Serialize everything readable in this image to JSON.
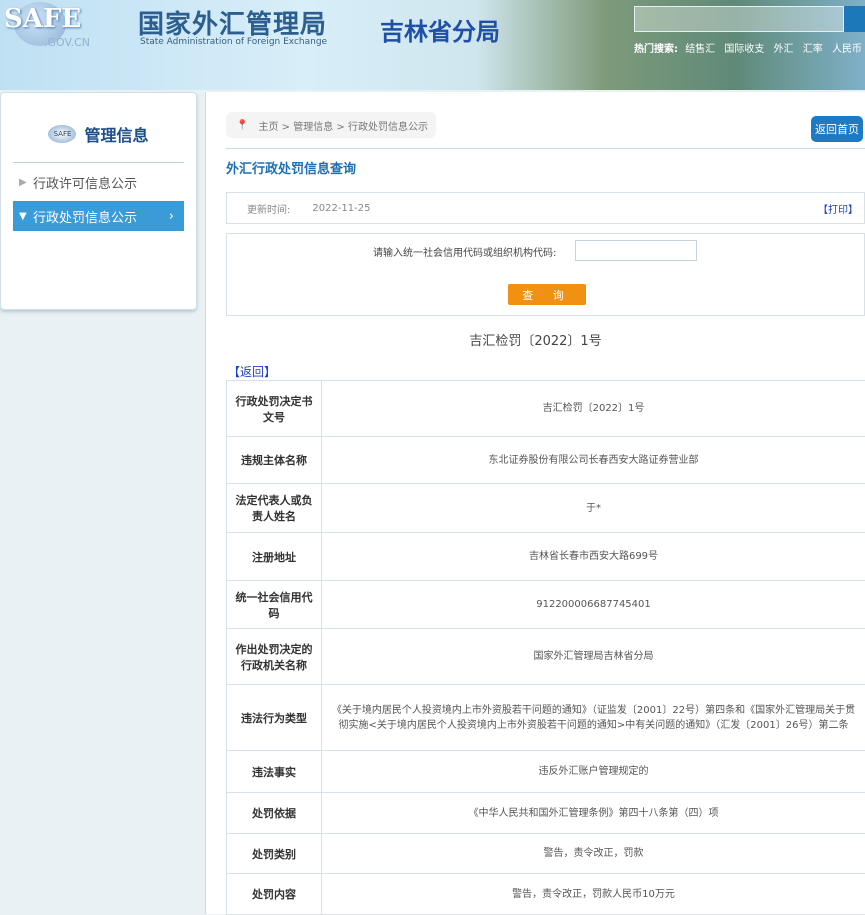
{
  "header": {
    "logo": "SAFE",
    "gov": ".GOV.CN",
    "title_cn": "国家外汇管理局",
    "title_en": "State Administration of Foreign Exchange",
    "branch": "吉林省分局",
    "hot_label": "热门搜索:",
    "hot_terms": [
      "结售汇",
      "国际收支",
      "外汇",
      "汇率",
      "人民币"
    ]
  },
  "sidebar": {
    "title": "管理信息",
    "items": [
      {
        "label": "行政许可信息公示"
      },
      {
        "label": "行政处罚信息公示"
      }
    ]
  },
  "breadcrumb": [
    "主页",
    "管理信息",
    "行政处罚信息公示"
  ],
  "home_button": "返回首页",
  "query_title": "外汇行政处罚信息查询",
  "update": {
    "label": "更新时间:",
    "date": "2022-11-25",
    "print": "【打印】"
  },
  "query": {
    "label": "请输入统一社会信用代码或组织机构代码:",
    "value": "",
    "button": "查 询"
  },
  "doc_number": "吉汇检罚〔2022〕1号",
  "back": "【返回】",
  "rows": [
    {
      "k": "行政处罚决定书文号",
      "v": "吉汇检罚〔2022〕1号"
    },
    {
      "k": "违规主体名称",
      "v": "东北证券股份有限公司长春西安大路证券营业部"
    },
    {
      "k": "法定代表人或负责人姓名",
      "v": "于*"
    },
    {
      "k": "注册地址",
      "v": "吉林省长春市西安大路699号"
    },
    {
      "k": "统一社会信用代码",
      "v": "912200006687745401"
    },
    {
      "k": "作出处罚决定的行政机关名称",
      "v": "国家外汇管理局吉林省分局"
    },
    {
      "k": "违法行为类型",
      "v": "《关于境内居民个人投资境内上市外资股若干问题的通知》（证监发〔2001〕22号）第四条和《国家外汇管理局关于贯彻实施<关于境内居民个人投资境内上市外资股若干问题的通知>中有关问题的通知》（汇发〔2001〕26号）第二条"
    },
    {
      "k": "违法事实",
      "v": "违反外汇账户管理规定的"
    },
    {
      "k": "处罚依据",
      "v": "《中华人民共和国外汇管理条例》第四十八条第（四）项"
    },
    {
      "k": "处罚类别",
      "v": "警告，责令改正，罚款"
    },
    {
      "k": "处罚内容",
      "v": "警告，责令改正，罚款人民币10万元"
    }
  ]
}
